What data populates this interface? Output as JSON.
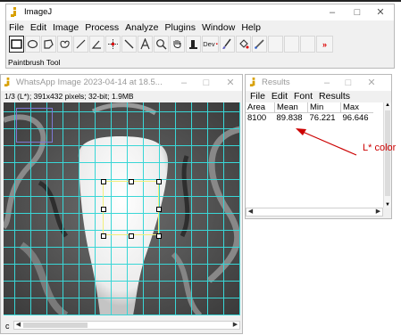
{
  "imagej": {
    "title": "ImageJ",
    "menu": [
      "File",
      "Edit",
      "Image",
      "Process",
      "Analyze",
      "Plugins",
      "Window",
      "Help"
    ],
    "status": "Paintbrush Tool",
    "tools": [
      {
        "name": "rectangle-select-icon",
        "selected": true
      },
      {
        "name": "oval-select-icon"
      },
      {
        "name": "polygon-select-icon"
      },
      {
        "name": "freehand-select-icon"
      },
      {
        "name": "line-tool-icon"
      },
      {
        "name": "angle-tool-icon"
      },
      {
        "name": "point-tool-icon"
      },
      {
        "name": "wand-tool-icon"
      },
      {
        "name": "text-tool-icon"
      },
      {
        "name": "magnifier-icon"
      },
      {
        "name": "hand-tool-icon"
      },
      {
        "name": "dropper-tool-icon"
      },
      {
        "name": "dev-menu-icon",
        "label": "Dev"
      },
      {
        "name": "paintbrush-icon"
      },
      {
        "name": "flood-fill-icon"
      },
      {
        "name": "pencil-icon"
      },
      {
        "name": "empty-slot-icon"
      },
      {
        "name": "empty-slot-icon"
      },
      {
        "name": "empty-slot-icon"
      },
      {
        "name": "more-tools-icon"
      }
    ]
  },
  "image_window": {
    "title": "WhatsApp Image 2023-04-14 at 18.5...",
    "info": "1/3 (L*); 391x432 pixels; 32-bit; 1.9MB",
    "channel_label": "c"
  },
  "results": {
    "title": "Results",
    "menu": [
      "File",
      "Edit",
      "Font",
      "Results"
    ],
    "headers": [
      "Area",
      "Mean",
      "Min",
      "Max"
    ],
    "rows": [
      [
        "8100",
        "89.838",
        "76.221",
        "96.646"
      ]
    ]
  },
  "annotation": {
    "text": "L* color",
    "color": "#cc0000"
  },
  "colors": {
    "grid": "#39d6d6",
    "roi": "#f2ee7a",
    "roi_small": "#7f78d6"
  }
}
